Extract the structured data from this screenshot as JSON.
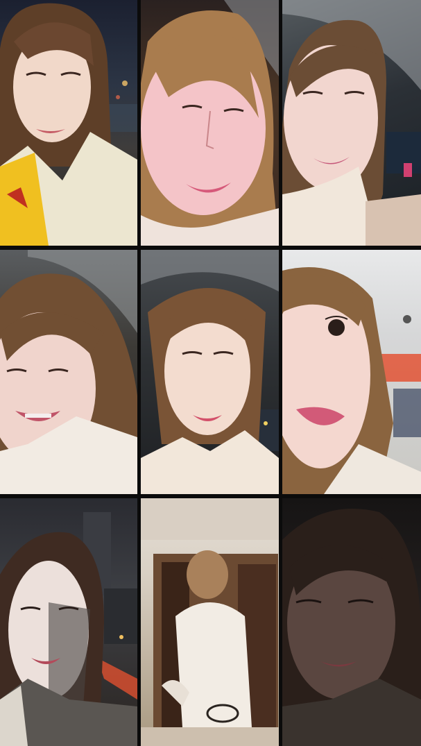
{
  "collage": {
    "layout": "3x3 grid",
    "tiles": [
      {
        "id": 1,
        "scene": "selfie-night-street-yellow-jacket"
      },
      {
        "id": 2,
        "scene": "selfie-close-up-warm-light"
      },
      {
        "id": 3,
        "scene": "selfie-under-clear-umbrella"
      },
      {
        "id": 4,
        "scene": "selfie-laughing-rainy-umbrella"
      },
      {
        "id": 5,
        "scene": "selfie-centered-umbrella-night"
      },
      {
        "id": 6,
        "scene": "selfie-indoor-mall-close-up"
      },
      {
        "id": 7,
        "scene": "selfie-night-city-wet-road"
      },
      {
        "id": 8,
        "scene": "person-back-view-walking-through-door"
      },
      {
        "id": 9,
        "scene": "selfie-dark-low-light"
      }
    ]
  }
}
